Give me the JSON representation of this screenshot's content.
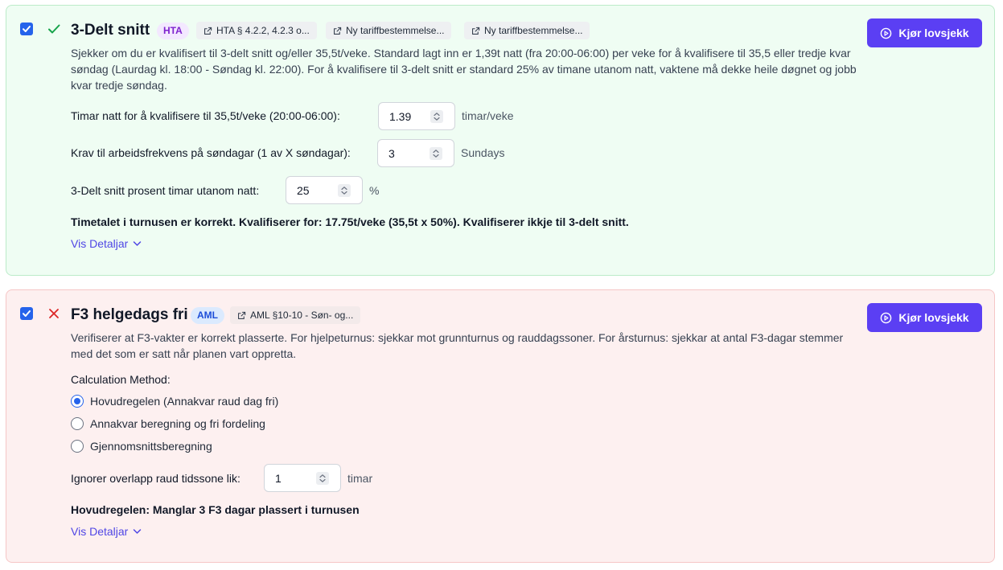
{
  "rules": [
    {
      "status": "pass",
      "enabled": true,
      "title": "3-Delt snitt",
      "badge": "HTA",
      "references": [
        "HTA § 4.2.2, 4.2.3 o...",
        "Ny tariffbestemmelse...",
        "Ny tariffbestemmelse..."
      ],
      "run_label": "Kjør lovsjekk",
      "description": "Sjekker om du er kvalifisert til 3-delt snitt og/eller 35,5t/veke. Standard lagt inn er 1,39t natt (fra 20:00-06:00) per veke for å kvalifisere til 35,5 eller tredje kvar søndag (Laurdag kl. 18:00 - Søndag kl. 22:00). For å kvalifisere til 3-delt snitt er standard 25% av timane utanom natt, vaktene må dekke heile døgnet og jobb kvar tredje søndag.",
      "fields": [
        {
          "label": "Timar natt for å kvalifisere til 35,5t/veke (20:00-06:00):",
          "value": "1.39",
          "unit": "timar/veke"
        },
        {
          "label": "Krav til arbeidsfrekvens på søndagar (1 av X søndagar):",
          "value": "3",
          "unit": "Sundays"
        },
        {
          "label": "3-Delt snitt prosent timar utanom natt:",
          "value": "25",
          "unit": "%"
        }
      ],
      "result": "Timetalet i turnusen er korrekt. Kvalifiserer for: 17.75t/veke (35,5t x 50%). Kvalifiserer ikkje til 3-delt snitt.",
      "details_label": "Vis Detaljar"
    },
    {
      "status": "fail",
      "enabled": true,
      "title": "F3 helgedags fri",
      "badge": "AML",
      "references": [
        "AML §10-10 - Søn- og..."
      ],
      "run_label": "Kjør lovsjekk",
      "description": "Verifiserer at F3-vakter er korrekt plasserte. For hjelpeturnus: sjekkar mot grunnturnus og rauddagssoner. For årsturnus: sjekkar at antal F3-dagar stemmer med det som er satt når planen vart oppretta.",
      "method_label": "Calculation Method:",
      "methods": [
        {
          "label": "Hovudregelen (Annakvar raud dag fri)",
          "selected": true
        },
        {
          "label": "Annakvar beregning og fri fordeling",
          "selected": false
        },
        {
          "label": "Gjennomsnittsberegning",
          "selected": false
        }
      ],
      "fields": [
        {
          "label": "Ignorer overlapp raud tidssone lik:",
          "value": "1",
          "unit": "timar"
        }
      ],
      "result": "Hovudregelen: Manglar 3 F3 dagar plassert i turnusen",
      "details_label": "Vis Detaljar"
    }
  ],
  "colors": {
    "pass_bg": "#effdf3",
    "pass_border": "#bcebc9",
    "fail_bg": "#fdf0f0",
    "fail_border": "#f6c6c6",
    "pass_icon": "#16a34a",
    "fail_icon": "#dc2626",
    "primary_button": "#5b3ff3",
    "checkbox": "#2563eb",
    "link": "#4f46e5"
  },
  "icons": {
    "checkbox": "checkmark-icon",
    "pass": "check-icon",
    "fail": "x-icon",
    "reference": "external-link-icon",
    "run": "play-circle-icon",
    "spinner": "chevron-up-down-icon",
    "details": "chevron-down-icon"
  }
}
